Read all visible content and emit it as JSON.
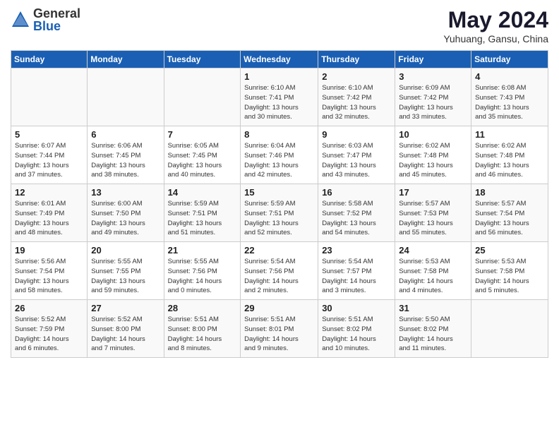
{
  "logo": {
    "general": "General",
    "blue": "Blue"
  },
  "title": "May 2024",
  "location": "Yuhuang, Gansu, China",
  "days_header": [
    "Sunday",
    "Monday",
    "Tuesday",
    "Wednesday",
    "Thursday",
    "Friday",
    "Saturday"
  ],
  "weeks": [
    [
      {
        "num": "",
        "info": ""
      },
      {
        "num": "",
        "info": ""
      },
      {
        "num": "",
        "info": ""
      },
      {
        "num": "1",
        "info": "Sunrise: 6:10 AM\nSunset: 7:41 PM\nDaylight: 13 hours\nand 30 minutes."
      },
      {
        "num": "2",
        "info": "Sunrise: 6:10 AM\nSunset: 7:42 PM\nDaylight: 13 hours\nand 32 minutes."
      },
      {
        "num": "3",
        "info": "Sunrise: 6:09 AM\nSunset: 7:42 PM\nDaylight: 13 hours\nand 33 minutes."
      },
      {
        "num": "4",
        "info": "Sunrise: 6:08 AM\nSunset: 7:43 PM\nDaylight: 13 hours\nand 35 minutes."
      }
    ],
    [
      {
        "num": "5",
        "info": "Sunrise: 6:07 AM\nSunset: 7:44 PM\nDaylight: 13 hours\nand 37 minutes."
      },
      {
        "num": "6",
        "info": "Sunrise: 6:06 AM\nSunset: 7:45 PM\nDaylight: 13 hours\nand 38 minutes."
      },
      {
        "num": "7",
        "info": "Sunrise: 6:05 AM\nSunset: 7:45 PM\nDaylight: 13 hours\nand 40 minutes."
      },
      {
        "num": "8",
        "info": "Sunrise: 6:04 AM\nSunset: 7:46 PM\nDaylight: 13 hours\nand 42 minutes."
      },
      {
        "num": "9",
        "info": "Sunrise: 6:03 AM\nSunset: 7:47 PM\nDaylight: 13 hours\nand 43 minutes."
      },
      {
        "num": "10",
        "info": "Sunrise: 6:02 AM\nSunset: 7:48 PM\nDaylight: 13 hours\nand 45 minutes."
      },
      {
        "num": "11",
        "info": "Sunrise: 6:02 AM\nSunset: 7:48 PM\nDaylight: 13 hours\nand 46 minutes."
      }
    ],
    [
      {
        "num": "12",
        "info": "Sunrise: 6:01 AM\nSunset: 7:49 PM\nDaylight: 13 hours\nand 48 minutes."
      },
      {
        "num": "13",
        "info": "Sunrise: 6:00 AM\nSunset: 7:50 PM\nDaylight: 13 hours\nand 49 minutes."
      },
      {
        "num": "14",
        "info": "Sunrise: 5:59 AM\nSunset: 7:51 PM\nDaylight: 13 hours\nand 51 minutes."
      },
      {
        "num": "15",
        "info": "Sunrise: 5:59 AM\nSunset: 7:51 PM\nDaylight: 13 hours\nand 52 minutes."
      },
      {
        "num": "16",
        "info": "Sunrise: 5:58 AM\nSunset: 7:52 PM\nDaylight: 13 hours\nand 54 minutes."
      },
      {
        "num": "17",
        "info": "Sunrise: 5:57 AM\nSunset: 7:53 PM\nDaylight: 13 hours\nand 55 minutes."
      },
      {
        "num": "18",
        "info": "Sunrise: 5:57 AM\nSunset: 7:54 PM\nDaylight: 13 hours\nand 56 minutes."
      }
    ],
    [
      {
        "num": "19",
        "info": "Sunrise: 5:56 AM\nSunset: 7:54 PM\nDaylight: 13 hours\nand 58 minutes."
      },
      {
        "num": "20",
        "info": "Sunrise: 5:55 AM\nSunset: 7:55 PM\nDaylight: 13 hours\nand 59 minutes."
      },
      {
        "num": "21",
        "info": "Sunrise: 5:55 AM\nSunset: 7:56 PM\nDaylight: 14 hours\nand 0 minutes."
      },
      {
        "num": "22",
        "info": "Sunrise: 5:54 AM\nSunset: 7:56 PM\nDaylight: 14 hours\nand 2 minutes."
      },
      {
        "num": "23",
        "info": "Sunrise: 5:54 AM\nSunset: 7:57 PM\nDaylight: 14 hours\nand 3 minutes."
      },
      {
        "num": "24",
        "info": "Sunrise: 5:53 AM\nSunset: 7:58 PM\nDaylight: 14 hours\nand 4 minutes."
      },
      {
        "num": "25",
        "info": "Sunrise: 5:53 AM\nSunset: 7:58 PM\nDaylight: 14 hours\nand 5 minutes."
      }
    ],
    [
      {
        "num": "26",
        "info": "Sunrise: 5:52 AM\nSunset: 7:59 PM\nDaylight: 14 hours\nand 6 minutes."
      },
      {
        "num": "27",
        "info": "Sunrise: 5:52 AM\nSunset: 8:00 PM\nDaylight: 14 hours\nand 7 minutes."
      },
      {
        "num": "28",
        "info": "Sunrise: 5:51 AM\nSunset: 8:00 PM\nDaylight: 14 hours\nand 8 minutes."
      },
      {
        "num": "29",
        "info": "Sunrise: 5:51 AM\nSunset: 8:01 PM\nDaylight: 14 hours\nand 9 minutes."
      },
      {
        "num": "30",
        "info": "Sunrise: 5:51 AM\nSunset: 8:02 PM\nDaylight: 14 hours\nand 10 minutes."
      },
      {
        "num": "31",
        "info": "Sunrise: 5:50 AM\nSunset: 8:02 PM\nDaylight: 14 hours\nand 11 minutes."
      },
      {
        "num": "",
        "info": ""
      }
    ]
  ]
}
